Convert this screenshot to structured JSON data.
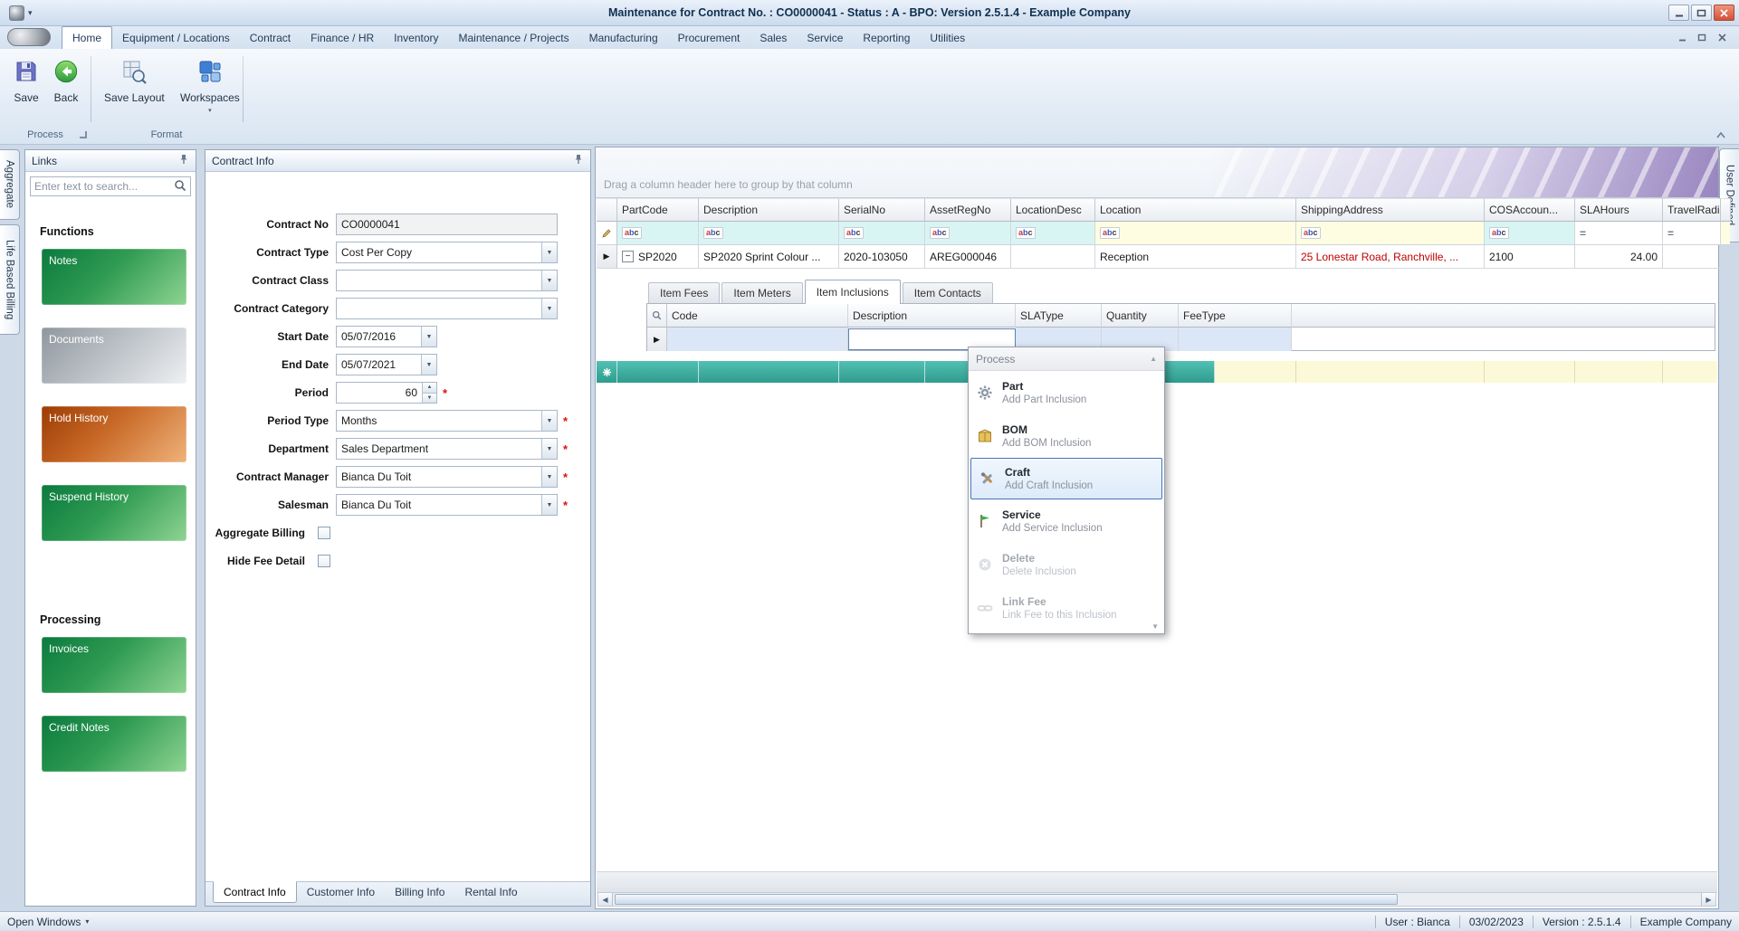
{
  "window": {
    "title": "Maintenance for Contract No. : CO0000041 - Status : A - BPO: Version 2.5.1.4 - Example Company"
  },
  "ribbon": {
    "tabs": [
      "Home",
      "Equipment / Locations",
      "Contract",
      "Finance / HR",
      "Inventory",
      "Maintenance / Projects",
      "Manufacturing",
      "Procurement",
      "Sales",
      "Service",
      "Reporting",
      "Utilities"
    ],
    "buttons": {
      "save": "Save",
      "back": "Back",
      "save_layout": "Save Layout",
      "workspaces": "Workspaces"
    },
    "groups": {
      "process": "Process",
      "format": "Format"
    }
  },
  "side_tabs": {
    "left": [
      "Aggregate",
      "Life Based Billing"
    ],
    "right": [
      "User Defined"
    ]
  },
  "links": {
    "title": "Links",
    "search_placeholder": "Enter text to search...",
    "functions_heading": "Functions",
    "processing_heading": "Processing",
    "function_buttons": [
      "Notes",
      "Documents",
      "Hold History",
      "Suspend History"
    ],
    "processing_buttons": [
      "Invoices",
      "Credit Notes"
    ]
  },
  "contract": {
    "title": "Contract Info",
    "required_marker": "*",
    "fields": [
      {
        "label": "Contract No",
        "value": "CO0000041"
      },
      {
        "label": "Contract Type",
        "value": "Cost Per Copy"
      },
      {
        "label": "Contract Class",
        "value": ""
      },
      {
        "label": "Contract Category",
        "value": ""
      },
      {
        "label": "Start Date",
        "value": "05/07/2016"
      },
      {
        "label": "End Date",
        "value": "05/07/2021"
      },
      {
        "label": "Period",
        "value": "60"
      },
      {
        "label": "Period Type",
        "value": "Months"
      },
      {
        "label": "Department",
        "value": "Sales Department"
      },
      {
        "label": "Contract Manager",
        "value": "Bianca Du Toit"
      },
      {
        "label": "Salesman",
        "value": "Bianca Du Toit"
      },
      {
        "label": "Aggregate Billing",
        "value": ""
      },
      {
        "label": "Hide Fee Detail",
        "value": ""
      }
    ],
    "bottom_tabs": [
      "Contract Info",
      "Customer Info",
      "Billing Info",
      "Rental Info"
    ]
  },
  "grid": {
    "group_hint": "Drag a column header here to group by that column",
    "columns": [
      "PartCode",
      "Description",
      "SerialNo",
      "AssetRegNo",
      "LocationDesc",
      "Location",
      "ShippingAddress",
      "COSAccoun...",
      "SLAHours",
      "TravelRadiu..."
    ],
    "row": [
      "SP2020",
      "SP2020 Sprint Colour ...",
      "2020-103050",
      "AREG000046",
      "",
      "Reception",
      "25 Lonestar Road, Ranchville, ...",
      "2100",
      "24.00",
      ""
    ],
    "detail": {
      "tabs": [
        "Item Fees",
        "Item Meters",
        "Item Inclusions",
        "Item Contacts"
      ],
      "columns": [
        "Code",
        "Description",
        "SLAType",
        "Quantity",
        "FeeType"
      ]
    }
  },
  "menu": {
    "header": "Process",
    "items": [
      {
        "title": "Part",
        "subtitle": "Add Part Inclusion"
      },
      {
        "title": "BOM",
        "subtitle": "Add BOM Inclusion"
      },
      {
        "title": "Craft",
        "subtitle": "Add Craft Inclusion"
      },
      {
        "title": "Service",
        "subtitle": "Add Service Inclusion"
      },
      {
        "title": "Delete",
        "subtitle": "Delete Inclusion"
      },
      {
        "title": "Link Fee",
        "subtitle": "Link Fee to this Inclusion"
      }
    ]
  },
  "status": {
    "open_windows": "Open Windows",
    "user": "User : Bianca",
    "date": "03/02/2023",
    "version": "Version : 2.5.1.4",
    "company": "Example Company"
  },
  "icons": {
    "dropdown": "▼",
    "spin_up": "▲",
    "spin_down": "▼",
    "row_arrow": "▶",
    "collapse_minus": "−",
    "equals_filter": "=",
    "abc_letters": [
      "a",
      "b",
      "c"
    ],
    "caret_down": "▾",
    "scroll_up": "▲",
    "scroll_down": "▼",
    "scroll_left": "◀",
    "scroll_right": "▶"
  },
  "colors": {
    "button_green": "#128a45",
    "button_gray": "#9ba3ab",
    "button_orange": "#b04a0a",
    "new_row_teal": "#38a99b",
    "alert_text_red": "#c00000",
    "highlight_border_blue": "#4a72b8",
    "filter_cyan": "#d9f5f3",
    "filter_yellow": "#fffde1"
  }
}
